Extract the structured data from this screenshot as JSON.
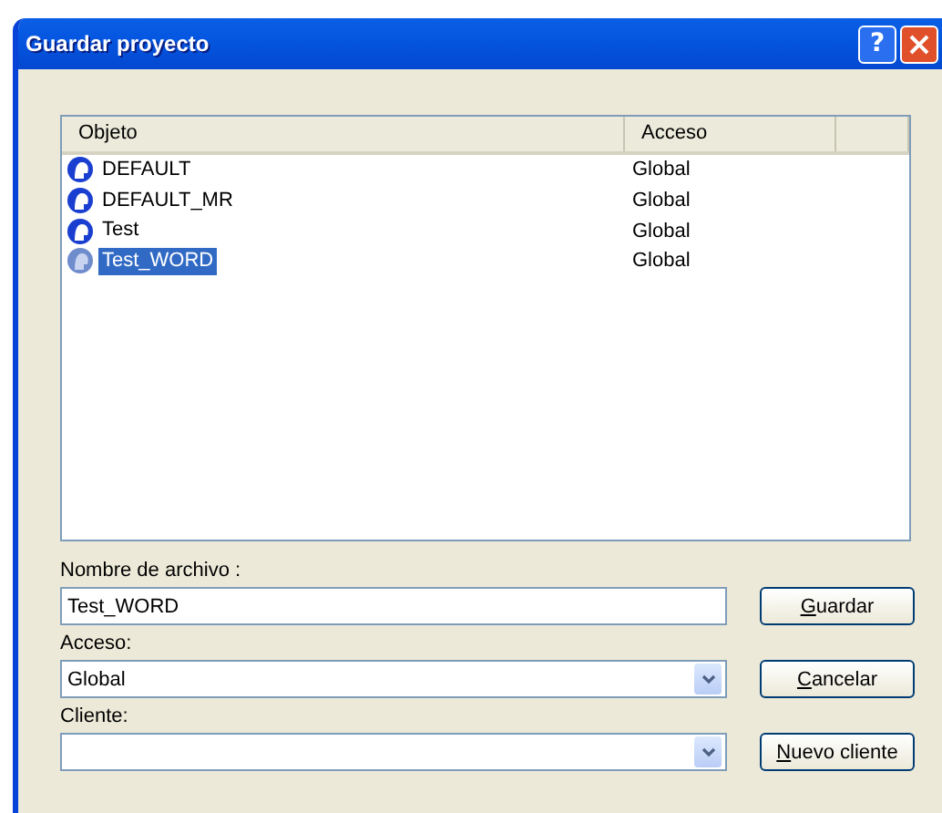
{
  "window": {
    "title": "Guardar proyecto"
  },
  "title_buttons": [
    {
      "kind": "help",
      "label": "?"
    },
    {
      "kind": "close"
    }
  ],
  "table": {
    "columns": [
      "Objeto",
      "Acceso"
    ],
    "rows": [
      {
        "name": "DEFAULT",
        "access": "Global",
        "selected": false
      },
      {
        "name": "DEFAULT_MR",
        "access": "Global",
        "selected": false
      },
      {
        "name": "Test",
        "access": "Global",
        "selected": false
      },
      {
        "name": "Test_WORD",
        "access": "Global",
        "selected": true
      }
    ]
  },
  "fields": [
    {
      "kind": "text",
      "label": "Nombre de archivo :",
      "value": "Test_WORD",
      "button": "Guardar"
    },
    {
      "kind": "combo",
      "label": "Acceso:",
      "value": "Global",
      "button": "Cancelar"
    },
    {
      "kind": "combo",
      "label": "Cliente:",
      "button": "Nuevo cliente"
    }
  ]
}
